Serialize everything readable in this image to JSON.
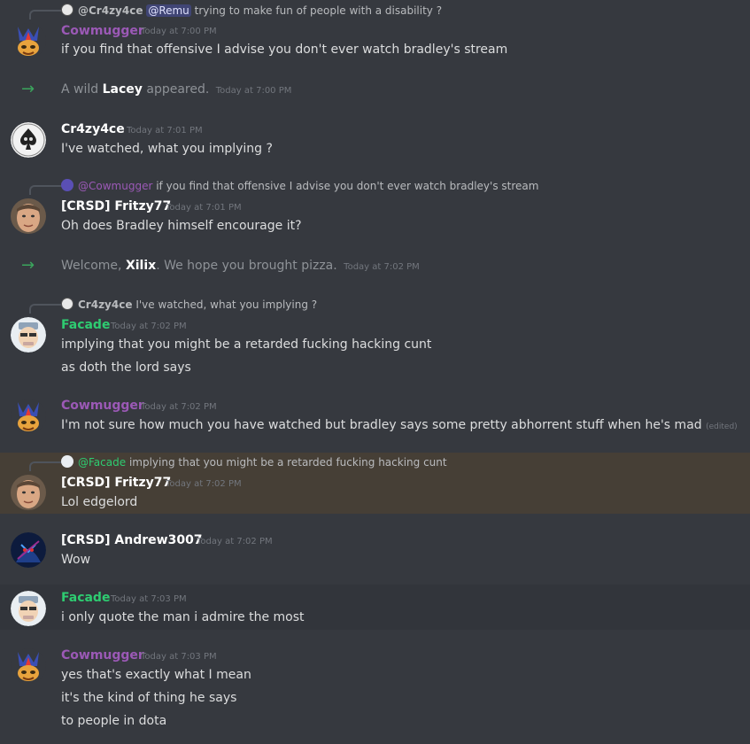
{
  "colors": {
    "background": "#36393f",
    "cowmugger": "#9b59b6",
    "facade": "#2ecc71",
    "white_name": "#ffffff",
    "highlight": "#463f36",
    "join_arrow": "#3ba55d"
  },
  "m1": {
    "reply_name": "@Cr4zy4ce",
    "reply_mention": "@Remu",
    "reply_text": "trying to make fun of people with a disability ?",
    "author": "Cowmugger",
    "time": "Today at 7:00 PM",
    "line1": "if you find that offensive I advise you don't ever watch bradley's stream"
  },
  "sys1": {
    "pre": "A wild",
    "name": "Lacey",
    "post": "appeared.",
    "time": "Today at 7:00 PM"
  },
  "m2": {
    "author": "Cr4zy4ce",
    "time": "Today at 7:01 PM",
    "line1": "I've watched, what you implying ?"
  },
  "m3": {
    "reply_name": "@Cowmugger",
    "reply_text": "if you find that offensive I advise you don't ever watch bradley's stream",
    "author": "[CRSD] Fritzy77",
    "time": "Today at 7:01 PM",
    "line1": "Oh does Bradley himself encourage it?"
  },
  "sys2": {
    "pre": "Welcome,",
    "name": "Xilix",
    "post": ". We hope you brought pizza.",
    "time": "Today at 7:02 PM"
  },
  "m4": {
    "reply_name": "Cr4zy4ce",
    "reply_text": "I've watched, what you implying ?",
    "author": "Facade",
    "time": "Today at 7:02 PM",
    "line1": "implying that you might be a retarded fucking hacking cunt",
    "line2": "as doth the lord says"
  },
  "m5": {
    "author": "Cowmugger",
    "time": "Today at 7:02 PM",
    "line1": "I'm not sure how much you have watched but bradley says some pretty abhorrent stuff when he's mad",
    "edited": "(edited)"
  },
  "m6": {
    "reply_name": "@Facade",
    "reply_text": "implying that you might be a retarded fucking hacking cunt",
    "author": "[CRSD] Fritzy77",
    "time": "Today at 7:02 PM",
    "line1": "Lol edgelord"
  },
  "m7": {
    "author": "[CRSD] Andrew3007",
    "time": "Today at 7:02 PM",
    "line1": "Wow"
  },
  "m8": {
    "author": "Facade",
    "time": "Today at 7:03 PM",
    "line1": "i only quote the man i admire the most"
  },
  "m9": {
    "author": "Cowmugger",
    "time": "Today at 7:03 PM",
    "line1": "yes that's exactly what I mean",
    "line2": "it's the kind of thing he says",
    "line3": "to people in dota"
  },
  "icons": {
    "cowmugger_avatar": "demon-mask-avatar-icon",
    "cr4zy4ce_avatar": "spade-skull-avatar-icon",
    "fritzy_avatar": "face-photo-avatar-icon",
    "facade_avatar": "cartoon-face-avatar-icon",
    "andrew_avatar": "dark-hero-avatar-icon",
    "join": "arrow-right-icon"
  }
}
